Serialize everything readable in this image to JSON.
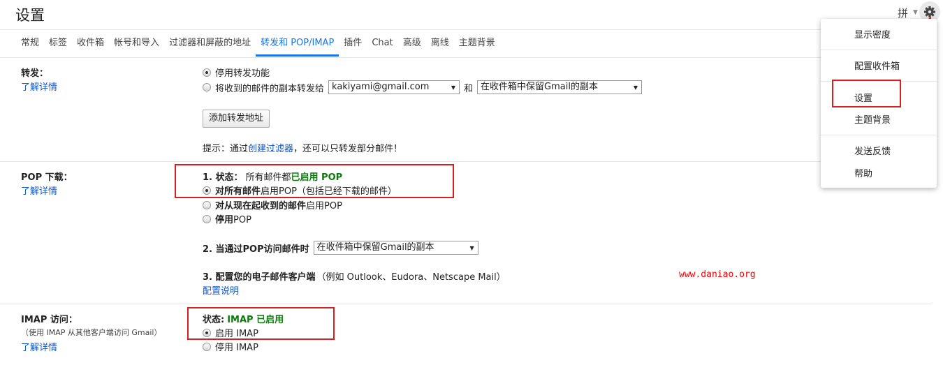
{
  "page_title": "设置",
  "ime_label": "拼",
  "tabs": [
    "常规",
    "标签",
    "收件箱",
    "帐号和导入",
    "过滤器和屏蔽的地址",
    "转发和 POP/IMAP",
    "插件",
    "Chat",
    "高级",
    "离线",
    "主题背景"
  ],
  "forwarding": {
    "label": "转发：",
    "learn_more": "了解详情",
    "disable_option": "停用转发功能",
    "forward_option": "将收到的邮件的副本转发给",
    "forward_address": "kakiyami@gmail.com",
    "and_text": "和",
    "keep_copy": "在收件箱中保留Gmail的副本",
    "add_button": "添加转发地址",
    "hint_prefix": "提示：通过",
    "hint_link": "创建过滤器",
    "hint_suffix": "，还可以只转发部分邮件！"
  },
  "pop": {
    "label": "POP 下载：",
    "learn_more": "了解详情",
    "status_label": "1. 状态：",
    "status_text": "所有邮件都",
    "status_value": "已启用 POP",
    "opt1_bold": "对所有邮件",
    "opt1_rest": "启用POP（包括已经下载的邮件）",
    "opt2_bold": "对从现在起收到的邮件",
    "opt2_rest": "启用POP",
    "opt3_bold": "停用",
    "opt3_rest": "POP",
    "step2_label": "2. 当通过POP访问邮件时",
    "step2_select": "在收件箱中保留Gmail的副本",
    "step3_label": "3. 配置您的电子邮件客户端",
    "step3_example": "（例如 Outlook、Eudora、Netscape Mail）",
    "config_link": "配置说明"
  },
  "imap": {
    "label": "IMAP 访问：",
    "sublabel": "（使用 IMAP 从其他客户端访问 Gmail）",
    "learn_more": "了解详情",
    "status_label": "状态:",
    "status_value": "IMAP 已启用",
    "enable_option": "启用 IMAP",
    "disable_option": "停用 IMAP"
  },
  "watermark": "www.daniao.org",
  "menu": {
    "items": [
      "显示密度",
      "配置收件箱",
      "设置",
      "主题背景",
      "发送反馈",
      "帮助"
    ]
  },
  "colors": {
    "accent": "#1a73e8",
    "link": "#1155cc",
    "highlight_box": "#d42020",
    "status_green": "#0a7a0a"
  }
}
